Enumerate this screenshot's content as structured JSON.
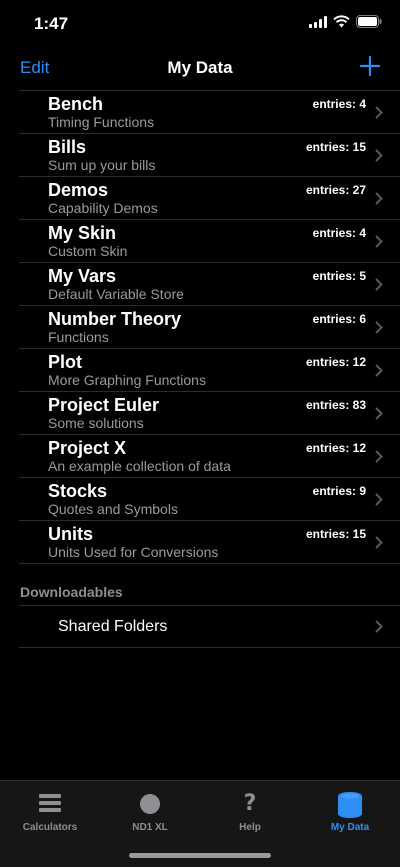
{
  "status": {
    "time": "1:47"
  },
  "nav": {
    "edit_label": "Edit",
    "title": "My Data"
  },
  "colors": {
    "accent": "#2f8ef5",
    "background": "#000000",
    "subtitle": "#9a9a9e",
    "separator": "#2c2c2e"
  },
  "items": [
    {
      "title": "Bench",
      "subtitle": "Timing Functions",
      "entries": "entries: 4"
    },
    {
      "title": "Bills",
      "subtitle": "Sum up your bills",
      "entries": "entries: 15"
    },
    {
      "title": "Demos",
      "subtitle": "Capability Demos",
      "entries": "entries: 27"
    },
    {
      "title": "My Skin",
      "subtitle": "Custom Skin",
      "entries": "entries: 4"
    },
    {
      "title": "My Vars",
      "subtitle": "Default Variable Store",
      "entries": "entries: 5"
    },
    {
      "title": "Number Theory",
      "subtitle": "Functions",
      "entries": "entries: 6"
    },
    {
      "title": "Plot",
      "subtitle": "More Graphing Functions",
      "entries": "entries: 12"
    },
    {
      "title": "Project Euler",
      "subtitle": "Some solutions",
      "entries": "entries: 83"
    },
    {
      "title": "Project X",
      "subtitle": "An example collection of data",
      "entries": "entries: 12"
    },
    {
      "title": "Stocks",
      "subtitle": "Quotes and Symbols",
      "entries": "entries: 9"
    },
    {
      "title": "Units",
      "subtitle": "Units Used for Conversions",
      "entries": "entries: 15"
    }
  ],
  "downloadables": {
    "header": "Downloadables",
    "shared_folders": "Shared Folders"
  },
  "tabs": [
    {
      "label": "Calculators",
      "icon": "list-icon"
    },
    {
      "label": "ND1 XL",
      "icon": "circle-icon"
    },
    {
      "label": "Help",
      "icon": "question-icon"
    },
    {
      "label": "My Data",
      "icon": "database-icon",
      "active": true
    }
  ]
}
